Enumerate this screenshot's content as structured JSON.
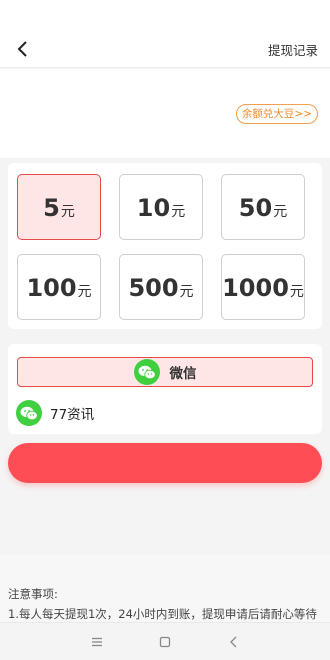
{
  "header": {
    "back_icon": "chevron-left-icon",
    "right_link": "提现记录"
  },
  "balance": {
    "exchange_link": "余额兑大豆>>"
  },
  "amounts": {
    "unit": "元",
    "selected_index": 0,
    "options": [
      {
        "value": "5"
      },
      {
        "value": "10"
      },
      {
        "value": "50"
      },
      {
        "value": "100"
      },
      {
        "value": "500"
      },
      {
        "value": "1000"
      }
    ]
  },
  "payment": {
    "method_label": "微信",
    "method_icon": "wechat-icon",
    "account_name": "77资讯"
  },
  "notes": {
    "title": "注意事项:",
    "items": [
      "1.每人每天提现1次，24小时内到账，提现申请后请耐心等待"
    ]
  },
  "system_nav": {
    "icons": [
      "menu-icon",
      "home-icon",
      "back-icon"
    ]
  },
  "colors": {
    "accent": "#ff4d55",
    "selected_bg": "#ffe6e6",
    "selected_border": "#e84a4a",
    "wechat_green": "#3fcf3f",
    "exchange_orange": "#ef8a2a"
  }
}
